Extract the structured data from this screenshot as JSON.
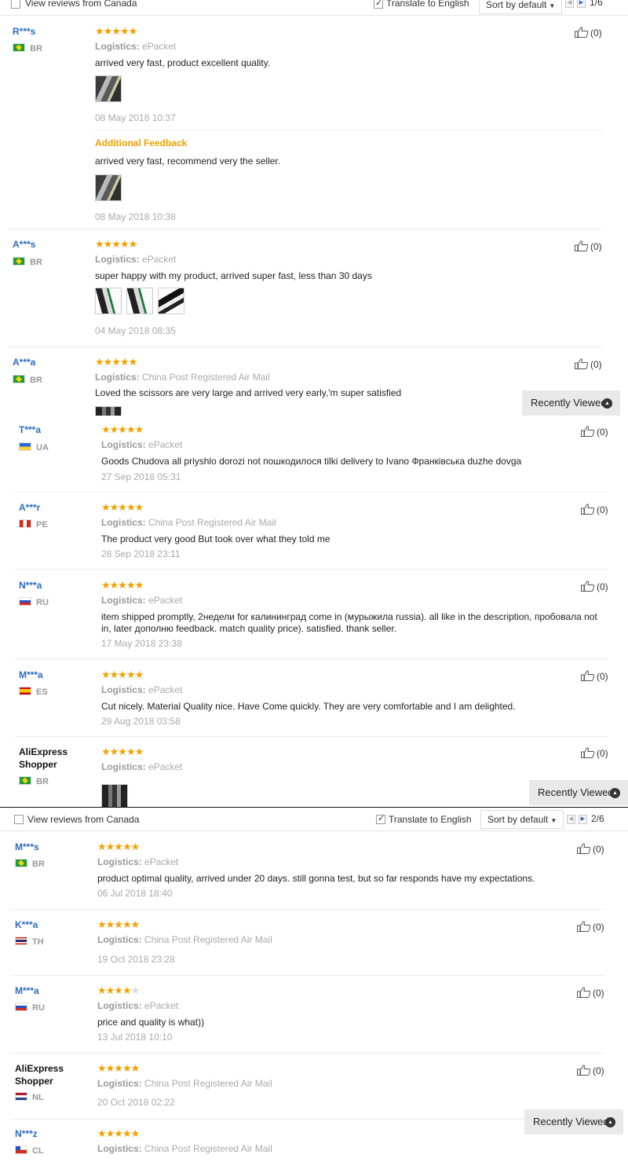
{
  "toolbar1": {
    "view_canada": "View reviews from Canada",
    "translate": "Translate to English",
    "sort": "Sort by default",
    "page": "1/6"
  },
  "toolbar2": {
    "view_canada": "View reviews from Canada",
    "translate": "Translate to English",
    "sort": "Sort by default",
    "page": "2/6"
  },
  "labels": {
    "logistics": "Logistics:",
    "additional_feedback": "Additional Feedback",
    "recently_viewed": "Recently Viewed"
  },
  "colors": {
    "star": "#f2a100",
    "username": "#2b6cc0",
    "additional_feedback": "#f0a000",
    "meta_gray": "#aaaaaa"
  },
  "panel1_reviews": [
    {
      "user": "R***s",
      "country": "BR",
      "stars": 5,
      "helpful": "(0)",
      "logistics": "ePacket",
      "text": "arrived very fast, product excellent quality.",
      "date": "08 May 2018 10:37",
      "additional_text": "arrived very fast, recommend very the seller.",
      "additional_date": "08 May 2018 10:38"
    },
    {
      "user": "A***s",
      "country": "BR",
      "stars": 5,
      "helpful": "(0)",
      "logistics": "ePacket",
      "text": "super happy with my product, arrived super fast, less than 30 days",
      "date": "04 May 2018 08:35"
    },
    {
      "user": "A***a",
      "country": "BR",
      "stars": 5,
      "helpful": "(0)",
      "logistics": "China Post Registered Air Mail",
      "text": "Loved the scissors are very large and arrived very early,'m super satisfied"
    }
  ],
  "panel2_reviews": [
    {
      "user": "T***a",
      "country": "UA",
      "stars": 5,
      "helpful": "(0)",
      "logistics": "ePacket",
      "text": "Goods Chudova all priyshlo dorozi not пошкодилося tilki delivery to Ivano Франківська duzhe dovga",
      "date": "27 Sep 2018 05:31"
    },
    {
      "user": "A***r",
      "country": "PE",
      "stars": 5,
      "helpful": "(0)",
      "logistics": "China Post Registered Air Mail",
      "text": "The product very good But took over what they told me",
      "date": "28 Sep 2018 23:11"
    },
    {
      "user": "N***a",
      "country": "RU",
      "stars": 5,
      "helpful": "(0)",
      "logistics": "ePacket",
      "text": "item shipped promptly, 2недели for калининград come in (мурыжила russia). all like in the description, пробовала not in, later дополню feedback. match quality price). satisfied. thank seller.",
      "date": "17 May 2018 23:38"
    },
    {
      "user": "M***a",
      "country": "ES",
      "stars": 5,
      "helpful": "(0)",
      "logistics": "ePacket",
      "text": "Cut nicely. Material Quality nice. Have Come quickly. They are very comfortable and I am delighted.",
      "date": "29 Aug 2018 03:58"
    },
    {
      "user": "AliExpress Shopper",
      "country": "BR",
      "stars": 5,
      "helpful": "(0)",
      "logistics": "ePacket"
    }
  ],
  "panel3_reviews": [
    {
      "user": "M***s",
      "country": "BR",
      "stars": 5,
      "helpful": "(0)",
      "logistics": "ePacket",
      "text": "product optimal quality, arrived under 20 days. still gonna test, but so far responds have my expectations.",
      "date": "06 Jul 2018 18:40"
    },
    {
      "user": "K***a",
      "country": "TH",
      "stars": 5,
      "helpful": "(0)",
      "logistics": "China Post Registered Air Mail",
      "date": "19 Oct 2018 23:28"
    },
    {
      "user": "M***a",
      "country": "RU",
      "stars": 4,
      "helpful": "(0)",
      "logistics": "ePacket",
      "text": "price and quality is what))",
      "date": "13 Jul 2018 10:10"
    },
    {
      "user": "AliExpress Shopper",
      "country": "NL",
      "stars": 5,
      "helpful": "(0)",
      "logistics": "China Post Registered Air Mail",
      "date": "20 Oct 2018 02:22"
    },
    {
      "user": "N***z",
      "country": "CL",
      "stars": 5,
      "helpful": "(0)",
      "logistics": "China Post Registered Air Mail"
    }
  ]
}
